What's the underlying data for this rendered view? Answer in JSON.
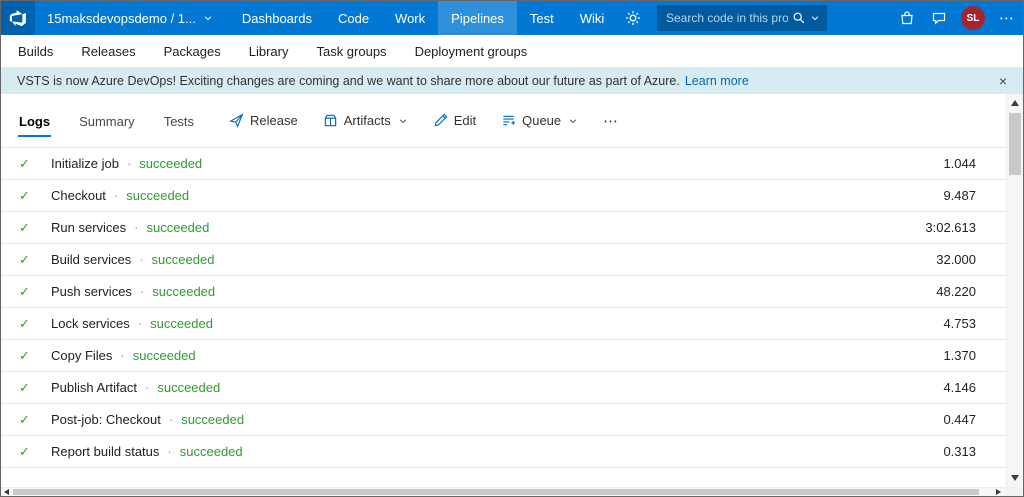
{
  "header": {
    "project_selector": "15maksdevopsdemo / 1...",
    "nav": [
      {
        "label": "Dashboards",
        "active": false
      },
      {
        "label": "Code",
        "active": false
      },
      {
        "label": "Work",
        "active": false
      },
      {
        "label": "Pipelines",
        "active": true
      },
      {
        "label": "Test",
        "active": false
      },
      {
        "label": "Wiki",
        "active": false
      }
    ],
    "search": {
      "placeholder": "Search code in this project"
    },
    "avatar": {
      "initials": "SL"
    }
  },
  "subnav": {
    "items": [
      {
        "label": "Builds"
      },
      {
        "label": "Releases"
      },
      {
        "label": "Packages"
      },
      {
        "label": "Library"
      },
      {
        "label": "Task groups"
      },
      {
        "label": "Deployment groups"
      }
    ]
  },
  "banner": {
    "message": "VSTS is now Azure DevOps! Exciting changes are coming and we want to share more about our future as part of Azure.",
    "link_label": "Learn more"
  },
  "tabs": [
    {
      "label": "Logs",
      "active": true
    },
    {
      "label": "Summary",
      "active": false
    },
    {
      "label": "Tests",
      "active": false
    }
  ],
  "toolbar": {
    "release": {
      "label": "Release"
    },
    "artifacts": {
      "label": "Artifacts",
      "has_dropdown": true
    },
    "edit": {
      "label": "Edit"
    },
    "queue": {
      "label": "Queue",
      "has_dropdown": true
    }
  },
  "steps": [
    {
      "name": "Initialize job",
      "status": "succeeded",
      "duration": "1.044"
    },
    {
      "name": "Checkout",
      "status": "succeeded",
      "duration": "9.487"
    },
    {
      "name": "Run services",
      "status": "succeeded",
      "duration": "3:02.613"
    },
    {
      "name": "Build services",
      "status": "succeeded",
      "duration": "32.000"
    },
    {
      "name": "Push services",
      "status": "succeeded",
      "duration": "48.220"
    },
    {
      "name": "Lock services",
      "status": "succeeded",
      "duration": "4.753"
    },
    {
      "name": "Copy Files",
      "status": "succeeded",
      "duration": "1.370"
    },
    {
      "name": "Publish Artifact",
      "status": "succeeded",
      "duration": "4.146"
    },
    {
      "name": "Post-job: Checkout",
      "status": "succeeded",
      "duration": "0.447"
    },
    {
      "name": "Report build status",
      "status": "succeeded",
      "duration": "0.313"
    }
  ],
  "icons": {
    "check": "✓",
    "dot": "·",
    "close": "×",
    "ellipsis": "⋯"
  },
  "colors": {
    "header_bg": "#0078d4",
    "search_bg": "#005a9e",
    "accent": "#0078d4",
    "icon": "#0067b8",
    "success": "#339933",
    "banner_bg": "#d6ecf2",
    "link": "#0067b8",
    "avatar_bg": "#a4262c"
  }
}
